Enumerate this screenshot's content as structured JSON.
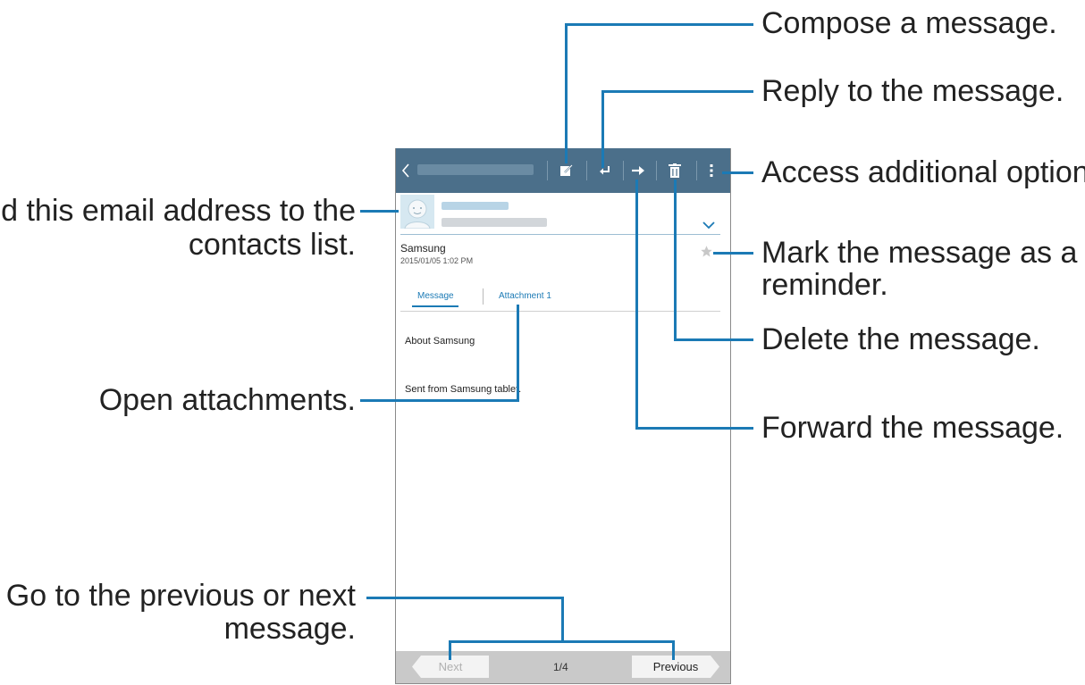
{
  "callouts": {
    "compose": "Compose a message.",
    "reply": "Reply to the message.",
    "options": "Access additional options.",
    "add_contact_line1": "Add this email address to the",
    "add_contact_line2": "contacts list.",
    "reminder_line1": "Mark the message as a",
    "reminder_line2": "reminder.",
    "delete": "Delete the message.",
    "attachments": "Open attachments.",
    "forward": "Forward the message.",
    "prev_next_line1": "Go to the previous or next",
    "prev_next_line2": "message."
  },
  "message": {
    "subject": "Samsung",
    "datetime": "2015/01/05  1:02 PM",
    "tabs": [
      "Message",
      "Attachment 1"
    ],
    "body_line1": "About Samsung",
    "body_line2": "Sent from Samsung tablet."
  },
  "navigation": {
    "next_label": "Next",
    "page_indicator": "1/4",
    "previous_label": "Previous"
  },
  "colors": {
    "action_bar": "#4b6f8a",
    "callout_line": "#1b7ab5",
    "active_tab": "#1b7ab5"
  },
  "icons": [
    "back-icon",
    "compose-icon",
    "reply-icon",
    "forward-icon",
    "delete-icon",
    "more-options-icon",
    "avatar-icon",
    "expand-chevron-icon",
    "star-icon"
  ]
}
